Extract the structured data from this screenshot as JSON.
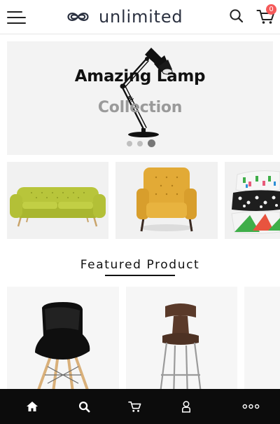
{
  "header": {
    "logo_text": "unlimited",
    "cart_count": "0"
  },
  "hero": {
    "title": "Amazing Lamp",
    "subtitle": "Collection",
    "slides": 3,
    "active_slide": 3
  },
  "categories": [
    {
      "item": "sofa"
    },
    {
      "item": "armchair"
    },
    {
      "item": "cushions"
    }
  ],
  "featured": {
    "title": "Featured Product"
  },
  "products": [
    {
      "item": "chair"
    },
    {
      "item": "bar-stool"
    },
    {
      "item": "product"
    }
  ],
  "bottom_nav": {
    "items": [
      "home-icon",
      "search-icon",
      "cart-icon",
      "user-icon",
      "more-icon"
    ]
  },
  "colors": {
    "accent_badge": "#f55a5a",
    "nav_bg": "#0c0c0c",
    "subtitle": "#9a9a9a",
    "logo_text": "#2b3140"
  }
}
